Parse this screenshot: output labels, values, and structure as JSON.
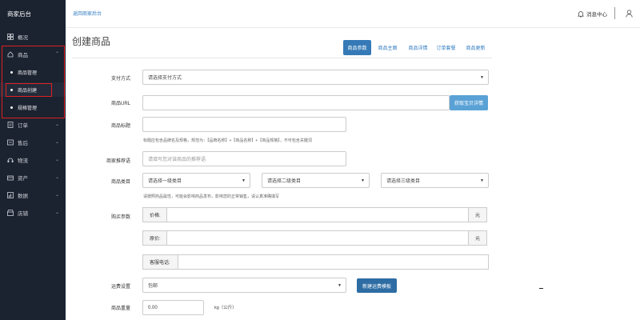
{
  "sidebar": {
    "brand": "商家后台",
    "items": [
      {
        "label": "概况",
        "icon": "dashboard-icon"
      },
      {
        "label": "商品",
        "icon": "home-icon"
      },
      {
        "label": "订单",
        "icon": "order-icon"
      },
      {
        "label": "售后",
        "icon": "after-sales-icon"
      },
      {
        "label": "物流",
        "icon": "headset-icon"
      },
      {
        "label": "资产",
        "icon": "asset-icon"
      },
      {
        "label": "数据",
        "icon": "data-icon"
      },
      {
        "label": "店铺",
        "icon": "store-icon"
      }
    ],
    "sub_items": [
      "商品管理",
      "商品创建",
      "规格管理"
    ]
  },
  "topbar": {
    "back_link": "返回商家后台",
    "message_center": "消息中心"
  },
  "page": {
    "title": "创建商品",
    "tabs": [
      "商品参数",
      "商品主图",
      "商品详情",
      "订单套餐",
      "商品更新"
    ]
  },
  "form": {
    "pay_method": {
      "label": "支付方式",
      "value": "请选择支付方式"
    },
    "product_url": {
      "label": "商品URL",
      "value": "",
      "button": "获取宝贝详情"
    },
    "product_title": {
      "label": "商品标题",
      "value": "",
      "hint": "标题应包含品牌名及规格，规范为：【品牌名称】+【商品名称】+【商品规格】，不可包含关键词"
    },
    "recommend": {
      "label": "商家推荐语",
      "placeholder": "请填写您对该商品的推荐语"
    },
    "category": {
      "label": "商品类目",
      "level1": "请选择一级类目",
      "level2": "请选择二级类目",
      "level3": "请选择三级类目",
      "hint": "请按照商品属性，可能会影响商品发布，影响您的正常销售，请认真准确填写"
    },
    "price": {
      "label": "购买参数",
      "price_label": "价格:",
      "original_label": "原价:",
      "unit": "元",
      "service_label": "客服电话:"
    },
    "shipping": {
      "label": "运费设置",
      "value": "包邮",
      "button": "新建运费模板"
    },
    "weight": {
      "label": "商品重量",
      "value": "0.00",
      "unit": "kg（公斤）"
    }
  },
  "colors": {
    "sidebar_bg": "#1b2230",
    "accent": "#357ab7",
    "highlight": "#e02020"
  }
}
